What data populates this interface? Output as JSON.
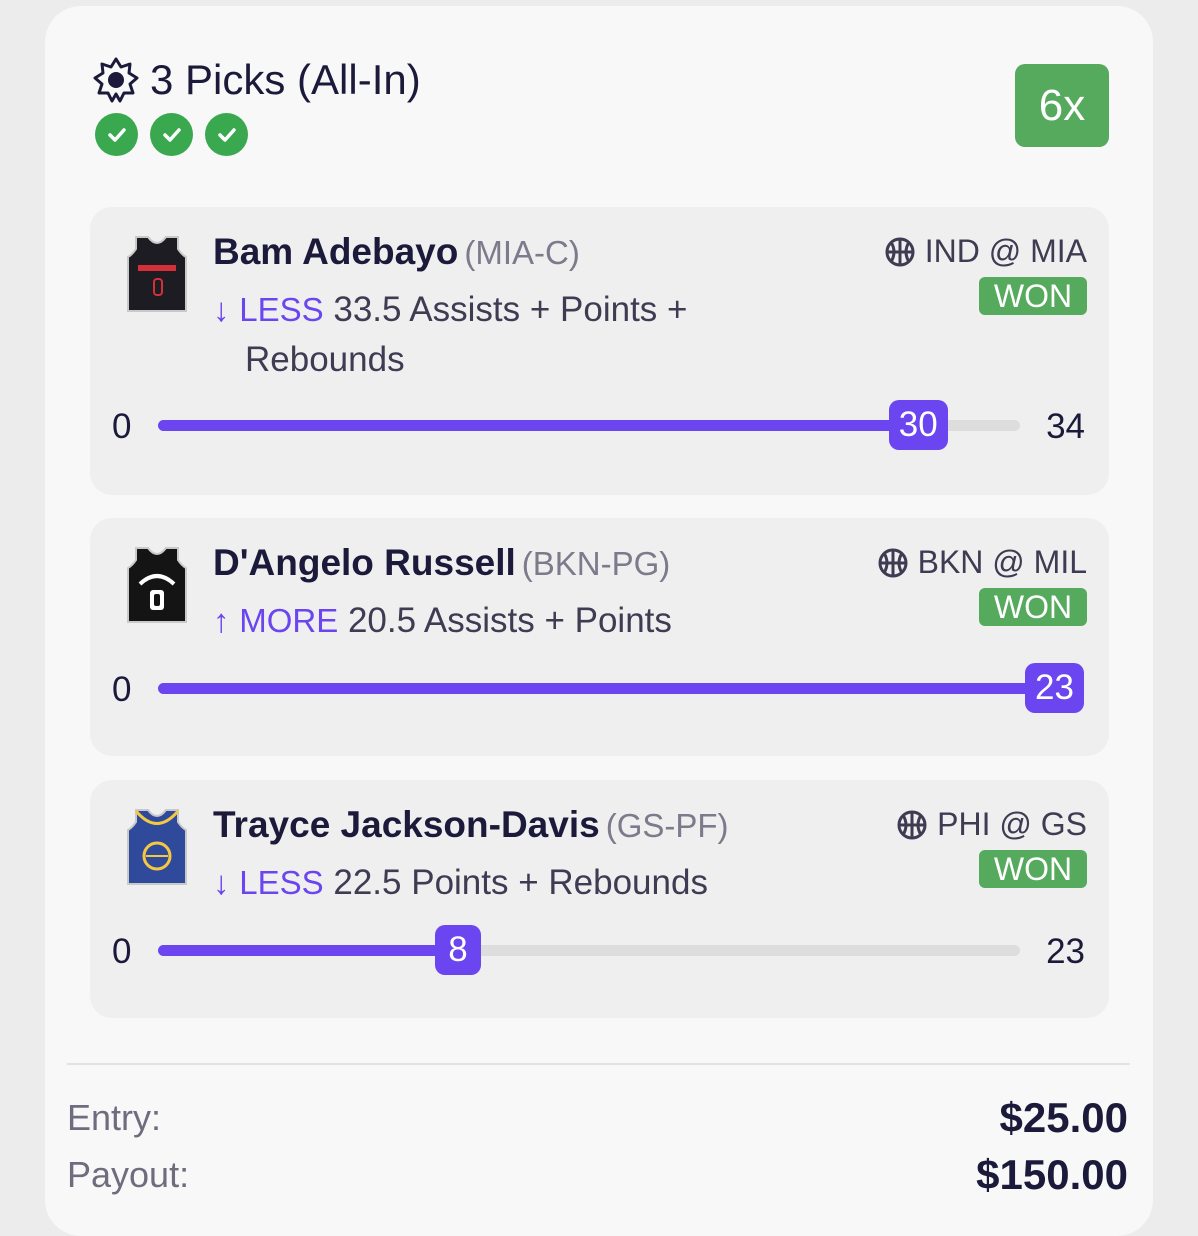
{
  "header": {
    "title": "3 Picks (All-In)",
    "multiplier": "6x",
    "icon": "sun-badge-icon"
  },
  "picks": [
    {
      "player": "Bam Adebayo",
      "position": "(MIA-C)",
      "direction": "LESS",
      "direction_arrow": "↓",
      "line": "33.5",
      "stat_first": "Assists + Points +",
      "stat_second": "Rebounds",
      "matchup": "IND @ MIA",
      "result": "WON",
      "min": "0",
      "max": "34",
      "actual": "30",
      "progress": 0.882,
      "jersey_color": "#1c1c22",
      "jersey_accent": "#d4303a"
    },
    {
      "player": "D'Angelo Russell",
      "position": "(BKN-PG)",
      "direction": "MORE",
      "direction_arrow": "↑",
      "line": "20.5",
      "stat_first": "Assists + Points",
      "matchup": "BKN @ MIL",
      "result": "WON",
      "min": "0",
      "actual": "23",
      "progress": 1.0,
      "jersey_color": "#141414",
      "jersey_accent": "#ffffff"
    },
    {
      "player": "Trayce Jackson-Davis",
      "position": "(GS-PF)",
      "direction": "LESS",
      "direction_arrow": "↓",
      "line": "22.5",
      "stat_first": "Points + Rebounds",
      "matchup": "PHI @ GS",
      "result": "WON",
      "min": "0",
      "max": "23",
      "actual": "8",
      "progress": 0.348,
      "jersey_color": "#2f4a9a",
      "jersey_accent": "#f5c842"
    }
  ],
  "summary": {
    "entry_label": "Entry:",
    "entry_value": "$25.00",
    "payout_label": "Payout:",
    "payout_value": "$150.00"
  },
  "colors": {
    "accent": "#6a45f0",
    "success": "#56aa5d"
  }
}
